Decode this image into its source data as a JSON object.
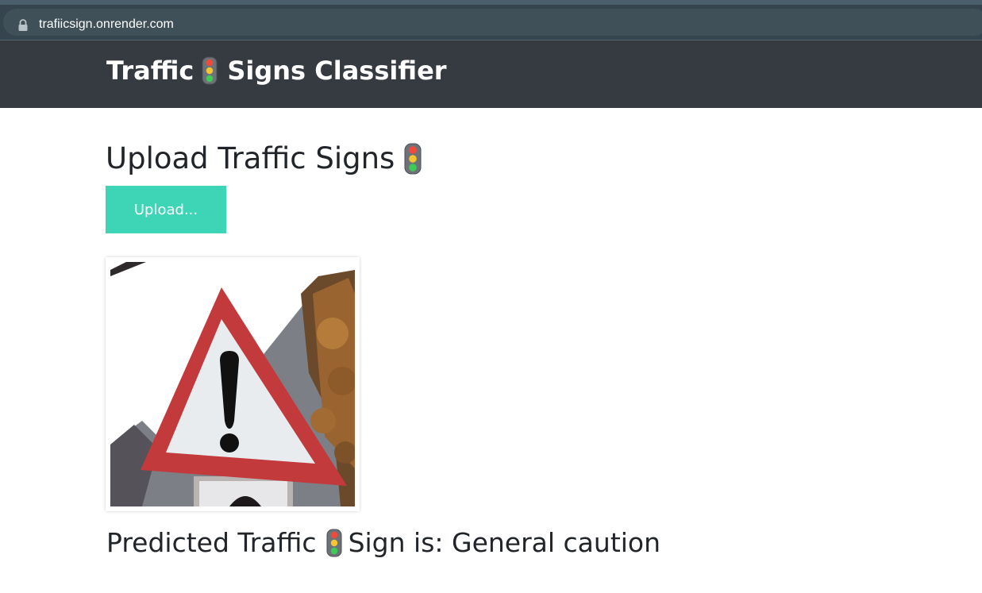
{
  "browser": {
    "url": "trafiicsign.onrender.com"
  },
  "navbar": {
    "brand_before": "Traffic",
    "brand_icon": "traffic-light-icon",
    "brand_after": "Signs Classifier"
  },
  "upload": {
    "heading": "Upload Traffic Signs",
    "heading_icon": "traffic-light-icon",
    "button_label": "Upload..."
  },
  "preview": {
    "image_icon": "general-caution-sign-photo"
  },
  "result": {
    "prefix": "Predicted Traffic",
    "icon": "traffic-light-icon",
    "suffix": "Sign is: General caution"
  },
  "colors": {
    "navbar_bg": "#363b42",
    "button_bg": "#3ed4b6",
    "text_dark": "#212529"
  }
}
